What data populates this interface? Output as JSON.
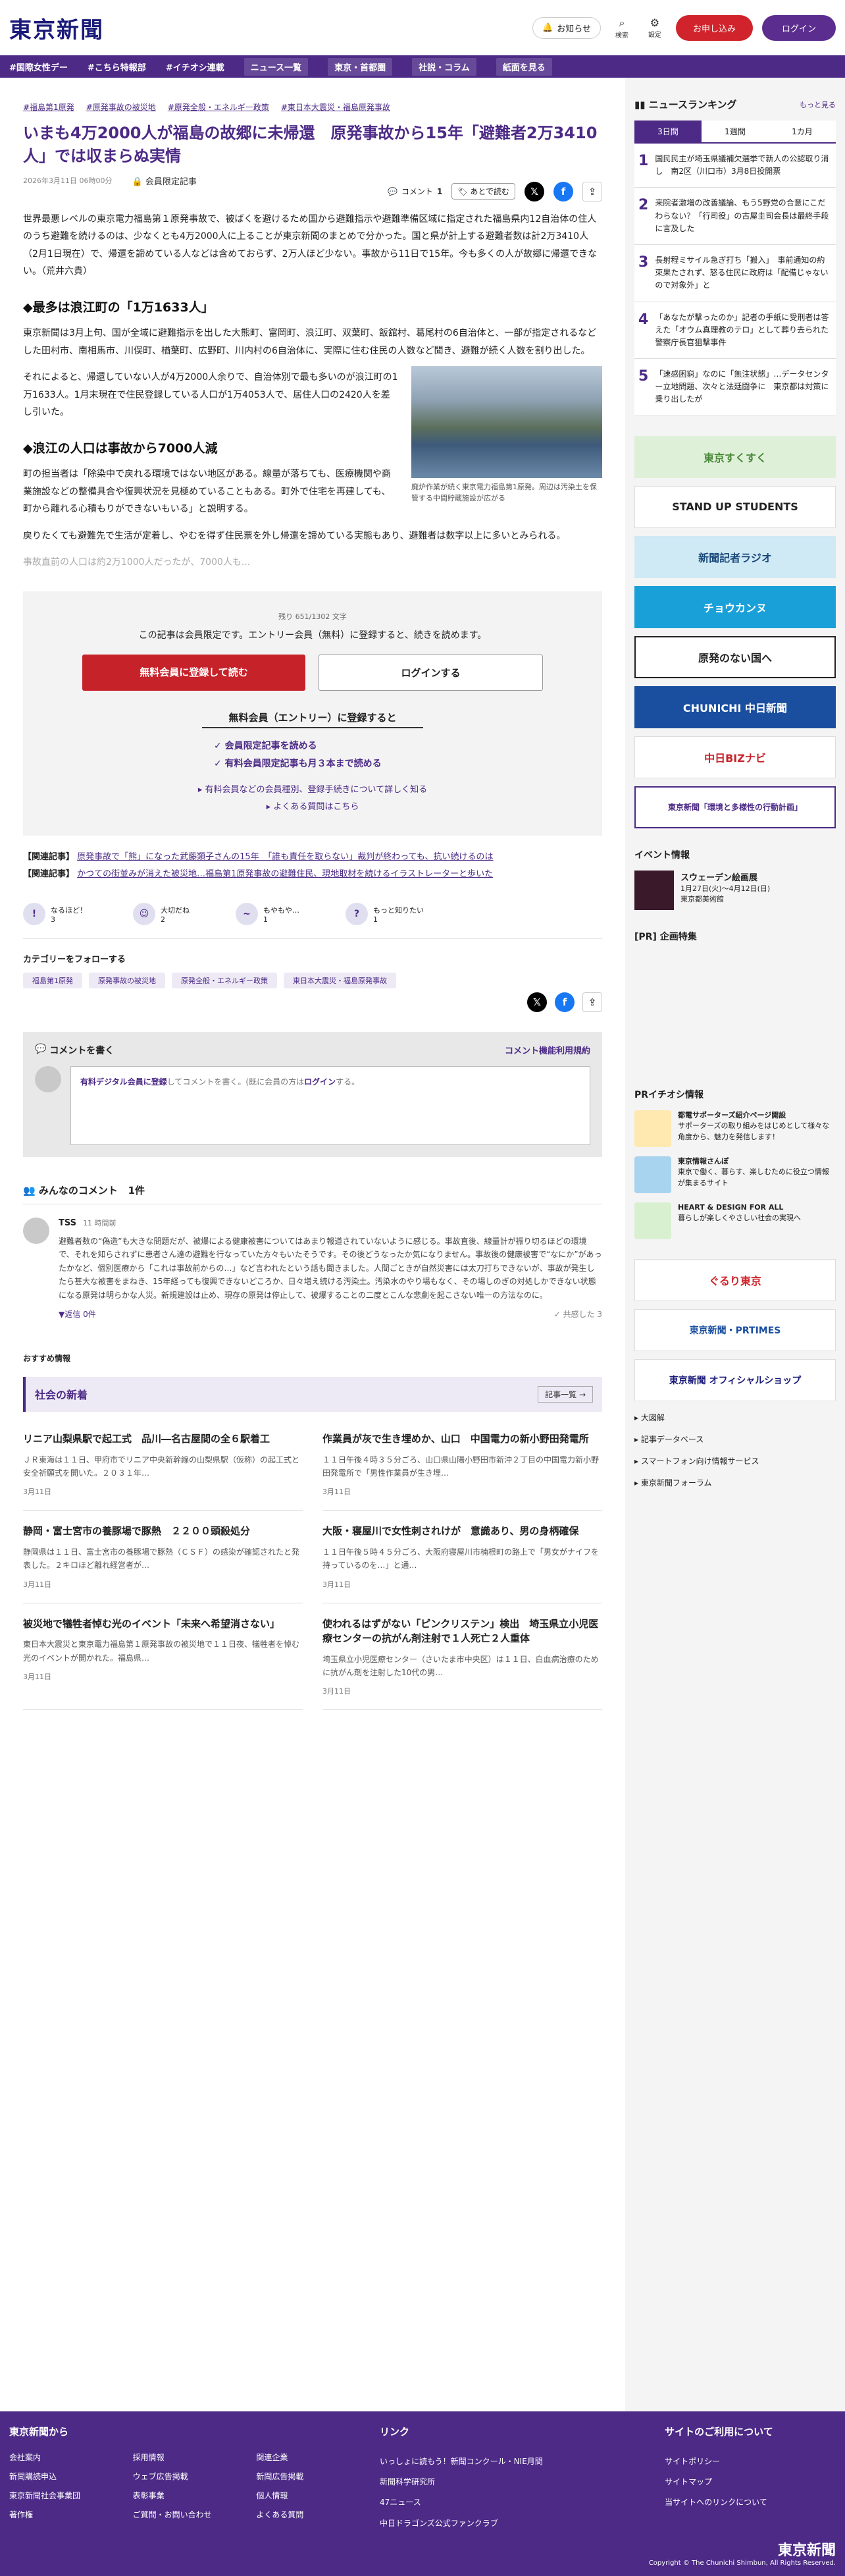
{
  "header": {
    "logo": "東京新聞",
    "notice": "お知らせ",
    "search": "検索",
    "settings": "設定",
    "apply": "お申し込み",
    "login": "ログイン"
  },
  "nav": [
    "#国際女性デー",
    "#こちら特報部",
    "#イチオシ連載",
    "ニュース一覧",
    "東京・首都圏",
    "社説・コラム",
    "紙面を見る"
  ],
  "article": {
    "tags": [
      "#福島第1原発",
      "#原発事故の被災地",
      "#原発全般・エネルギー政策",
      "#東日本大震災・福島原発事故"
    ],
    "title": "いまも4万2000人が福島の故郷に未帰還　原発事故から15年「避難者2万3410人」では収まらぬ実情",
    "date": "2026年3月11日 06時00分",
    "members_only": "会員限定記事",
    "comment_label": "コメント",
    "comment_count": "1",
    "read_later": "あとで読む",
    "p1": "世界最悪レベルの東京電力福島第１原発事故で、被ばくを避けるため国から避難指示や避難準備区域に指定された福島県内12自治体の住人のうち避難を続けるのは、少なくとも4万2000人に上ることが東京新聞のまとめで分かった。国と県が計上する避難者数は計2万3410人（2月1日現在）で、帰還を諦めている人などは含めておらず、2万人ほど少ない。事故から11日で15年。今も多くの人が故郷に帰還できない。（荒井六貴）",
    "h1": "◆最多は浪江町の「1万1633人」",
    "p2": "東京新聞は3月上旬、国が全域に避難指示を出した大熊町、富岡町、浪江町、双葉町、飯舘村、葛尾村の6自治体と、一部が指定されるなどした田村市、南相馬市、川俣町、楢葉町、広野町、川内村の6自治体に、実際に住む住民の人数など聞き、避難が続く人数を割り出した。",
    "p3": "それによると、帰還していない人が4万2000人余りで、自治体別で最も多いのが浪江町の1万1633人。1月末現在で住民登録している人口が1万4053人で、居住人口の2420人を差し引いた。",
    "h2": "◆浪江の人口は事故から7000人減",
    "p4": "町の担当者は「除染中で戻れる環境ではない地区がある。線量が落ちても、医療機関や商業施設などの整備具合や復興状況を見極めていることもある。町外で住宅を再建しても、町から離れる心積もりができないもいる」と説明する。",
    "p5": "戻りたくても避難先で生活が定着し、やむを得ず住民票を外し帰還を諦めている実態もあり、避難者は数字以上に多いとみられる。",
    "p6": "事故直前の人口は約2万1000人だったが、7000人も...",
    "photo_caption": "廃炉作業が続く東京電力福島第1原発。周辺は汚染土を保管する中間貯蔵施設が広がる"
  },
  "paywall": {
    "remaining": "残り 651/1302 文字",
    "msg": "この記事は会員限定です。エントリー会員（無料）に登録すると、続きを読めます。",
    "register": "無料会員に登録して読む",
    "login": "ログインする",
    "sub": "無料会員（エントリー）に登録すると",
    "benefits": [
      "会員限定記事を読める",
      "有料会員限定記事も月３本まで読める"
    ],
    "link1": "有料会員などの会員種別、登録手続きについて詳しく知る",
    "link2": "よくある質問はこちら"
  },
  "related": [
    {
      "label": "【関連記事】",
      "text": "原発事故で「熊」になった武藤類子さんの15年　「誰も責任を取らない」裁判が終わっても、抗い続けるのは"
    },
    {
      "label": "【関連記事】",
      "text": "かつての街並みが消えた被災地…福島第1原発事故の避難住民、現地取材を続けるイラストレーターと歩いた"
    }
  ],
  "reactions": [
    {
      "label": "なるほど！",
      "count": "3"
    },
    {
      "label": "大切だね",
      "count": "2"
    },
    {
      "label": "もやもや…",
      "count": "1"
    },
    {
      "label": "もっと知りたい",
      "count": "1"
    }
  ],
  "categories": {
    "title": "カテゴリーをフォローする",
    "chips": [
      "福島第1原発",
      "原発事故の被災地",
      "原発全般・エネルギー政策",
      "東日本大震災・福島原発事故"
    ]
  },
  "comment_box": {
    "title": "コメントを書く",
    "policy": "コメント機能利用規約",
    "prompt_link": "有料デジタル会員に登録",
    "prompt_rest": "してコメントを書く。(既に会員の方は",
    "prompt_login": "ログイン",
    "prompt_end": "する。"
  },
  "comments": {
    "title": "みんなのコメント",
    "count": "1件",
    "items": [
      {
        "name": "TSS",
        "time": "11 時間前",
        "text": "避難者数の“偽造”も大きな問題だが、被爆による健康被害についてはあまり報道されていないように感じる。事故直後、線量計が振り切るほどの環境で、それを知らされずに患者さん達の避難を行なっていた方々もいたそうです。その後どうなったか気になりません。事故後の健康被害で“なにか”があったかなど、個別医療から「これは事故前からの…」など言われたという話も聞きました。人間ごときが自然災害には太刀打ちできないが、事故が発生したら甚大な被害をまねき、15年経っても復興できないどころか、日々増え続ける汚染土。汚染水のやり場もなく、その場しのぎの対処しかできない状態になる原発は明らかな人災。新規建設は止め、現存の原発は停止して、被爆することの二度とこんな悲劇を起こさない唯一の方法なのに。",
        "reply": "返信",
        "reply_count": "0件",
        "agree": "共感した",
        "agree_count": "3"
      }
    ]
  },
  "recommend": "おすすめ情報",
  "social": {
    "title": "社会の新着",
    "more": "記事一覧",
    "items": [
      {
        "title": "リニア山梨県駅で起工式　品川―名古屋間の全６駅着工",
        "summary": "ＪＲ東海は１１日、甲府市でリニア中央新幹線の山梨県駅（仮称）の起工式と安全祈願式を開いた。２０３１年…",
        "date": "3月11日"
      },
      {
        "title": "作業員が灰で生き埋めか、山口　中国電力の新小野田発電所",
        "summary": "１１日午後４時３５分ごろ、山口県山陽小野田市新沖２丁目の中国電力新小野田発電所で「男性作業員が生き埋…",
        "date": "3月11日"
      },
      {
        "title": "静岡・富士宮市の養豚場で豚熱　２２００頭殺処分",
        "summary": "静岡県は１１日、富士宮市の養豚場で豚熱（ＣＳＦ）の感染が確認されたと発表した。２キロほど離れ経営者が…",
        "date": "3月11日"
      },
      {
        "title": "大阪・寝屋川で女性刺されけが　意識あり、男の身柄確保",
        "summary": "１１日午後５時４５分ごろ、大阪府寝屋川市楠根町の路上で「男女がナイフを持っているのを…」と通…",
        "date": "3月11日"
      },
      {
        "title": "被災地で犠牲者悼む光のイベント「未来へ希望消さない」",
        "summary": "東日本大震災と東京電力福島第１原発事故の被災地で１１日夜、犠牲者を悼む光のイベントが開かれた。福島県…",
        "date": "3月11日"
      },
      {
        "title": "使われるはずがない「ピンクリステン」検出　埼玉県立小児医療センターの抗がん剤注射で１人死亡２人重体",
        "summary": "埼玉県立小児医療センター（さいたま市中央区）は１１日、白血病治療のために抗がん剤を注射した10代の男…",
        "date": "3月11日"
      }
    ]
  },
  "ranking": {
    "title": "ニュースランキング",
    "more": "もっと見る",
    "tabs": [
      "3日間",
      "1週間",
      "1カ月"
    ],
    "items": [
      "国民民主が埼玉県議補欠選挙で新人の公認取り消し　南2区（川口市）3月8日投開票",
      "来院者激増の改善議論、もう5野党の合意にこだわらない？「行司役」の古屋圭司会長は最終手段に言及した",
      "長射程ミサイル急ぎ打ち「搬入」　事前通知の約束果たされず、怒る住民に政府は「配備じゃないので対象外」と",
      "「あなたが撃ったのか」記者の手紙に受刑者は答えた「オウム真理教のテロ」として葬り去られた警察庁長官狙撃事件",
      "「速感困窮」なのに「無注状態」…データセンター立地問題、次々と法廷闘争に　東京都は対策に乗り出したが"
    ]
  },
  "banners": [
    "東京すくすく",
    "STAND UP STUDENTS",
    "新聞記者ラジオ",
    "チョウカンヌ",
    "原発のない国へ",
    "CHUNICHI 中日新聞",
    "中日BIZナビ",
    "東京新聞「環境と多様性の行動計画」"
  ],
  "events": {
    "title": "イベント情報",
    "name": "スウェーデン絵画展",
    "dates": "1月27日(火)～4月12日(日)",
    "place": "東京都美術館"
  },
  "pr_plan": "[PR] 企画特集",
  "pr_info": {
    "title": "PRイチオシ情報",
    "items": [
      {
        "title": "都電サポーターズ紹介ページ開設",
        "desc": "サポーターズの取り組みをはじめとして様々な角度から、魅力を発信します！"
      },
      {
        "title": "東京情報さんぽ",
        "desc": "東京で働く、暮らす、楽しむために役立つ情報が集まるサイト"
      },
      {
        "title": "HEART & DESIGN FOR ALL",
        "desc": "暮らしが楽しくやさしい社会の実現へ"
      }
    ]
  },
  "side_banners2": [
    "ぐるり東京",
    "東京新聞・PRTIMES",
    "東京新聞 オフィシャルショップ"
  ],
  "side_links": [
    "大図解",
    "記事データベース",
    "スマートフォン向け情報サービス",
    "東京新聞フォーラム"
  ],
  "footer": {
    "col1_title": "東京新聞から",
    "col1": [
      "会社案内",
      "採用情報",
      "関連企業",
      "新聞購読申込",
      "ウェブ広告掲載",
      "新聞広告掲載",
      "東京新聞社会事業団",
      "表彰事業",
      "個人情報",
      "著作権",
      "ご質問・お問い合わせ",
      "よくある質問"
    ],
    "col2_title": "リンク",
    "col2": [
      "いっしょに読もう！新聞コンクール・NIE月間",
      "新聞科学研究所",
      "47ニュース",
      "中日ドラゴンズ公式ファンクラブ"
    ],
    "col3_title": "サイトのご利用について",
    "col3": [
      "サイトポリシー",
      "サイトマップ",
      "当サイトへのリンクについて"
    ],
    "logo": "東京新聞",
    "copyright": "Copyright © The Chunichi Shimbun, All Rights Reserved."
  }
}
